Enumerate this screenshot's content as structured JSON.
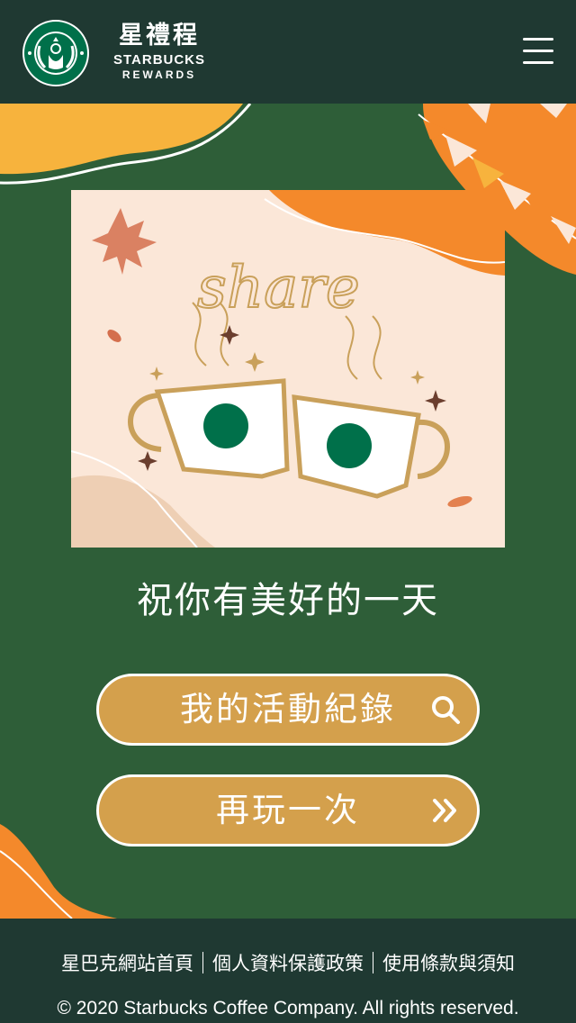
{
  "header": {
    "logo": "starbucks-siren-logo",
    "brand_zh": "星禮程",
    "brand_en": "STARBUCKS",
    "brand_sub": "REWARDS",
    "menu_icon": "hamburger-menu-icon"
  },
  "illustration": {
    "script_text": "share"
  },
  "main": {
    "greeting": "祝你有美好的一天",
    "activity_button": "我的活動紀錄",
    "activity_icon": "search-icon",
    "play_again_button": "再玩一次",
    "play_again_icon": "double-chevron-right-icon"
  },
  "footer": {
    "links": [
      "星巴克網站首頁",
      "個人資料保護政策",
      "使用條款與須知"
    ],
    "copyright": "© 2020 Starbucks Coffee Company. All rights reserved."
  },
  "colors": {
    "header_bg": "#1f3932",
    "main_bg": "#2e5e38",
    "button": "#d4a04c",
    "accent_orange": "#f4892b",
    "accent_yellow": "#f7b33d",
    "cup_green": "#00704a",
    "illustration_bg": "#fbe7d8"
  }
}
